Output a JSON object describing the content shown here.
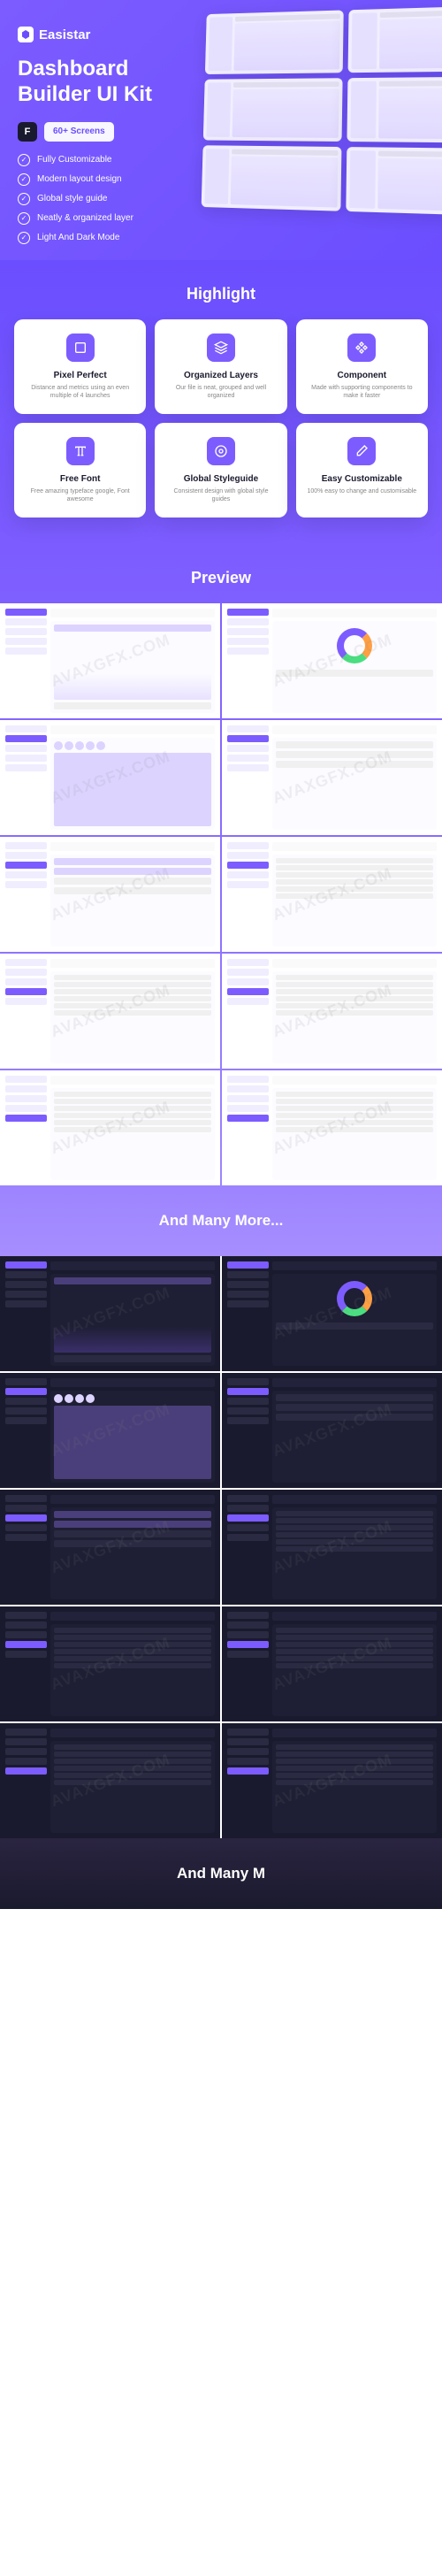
{
  "brand": {
    "name": "Easistar"
  },
  "hero": {
    "title_line1": "Dashboard",
    "title_line2": "Builder UI Kit",
    "badge_figma": "F",
    "badge_screens": "60+ Screens",
    "features": [
      "Fully Customizable",
      "Modern layout design",
      "Global style guide",
      "Neatly & organized layer",
      "Light And Dark Mode"
    ]
  },
  "sections": {
    "highlight": "Highlight",
    "preview": "Preview",
    "many_more": "And Many More...",
    "many_more_2": "And Many M"
  },
  "highlights": [
    {
      "title": "Pixel Perfect",
      "desc": "Distance and metrics using an even multiple of 4 launches"
    },
    {
      "title": "Organized Layers",
      "desc": "Our file is neat, grouped and well organized"
    },
    {
      "title": "Component",
      "desc": "Made with supporting components to make it faster"
    },
    {
      "title": "Free Font",
      "desc": "Free amazing typeface google, Font awesome"
    },
    {
      "title": "Global Styleguide",
      "desc": "Consistent design with global style guides"
    },
    {
      "title": "Easy Customizable",
      "desc": "100% easy to change and customisable"
    }
  ],
  "watermark": "AVAXGFX.COM"
}
